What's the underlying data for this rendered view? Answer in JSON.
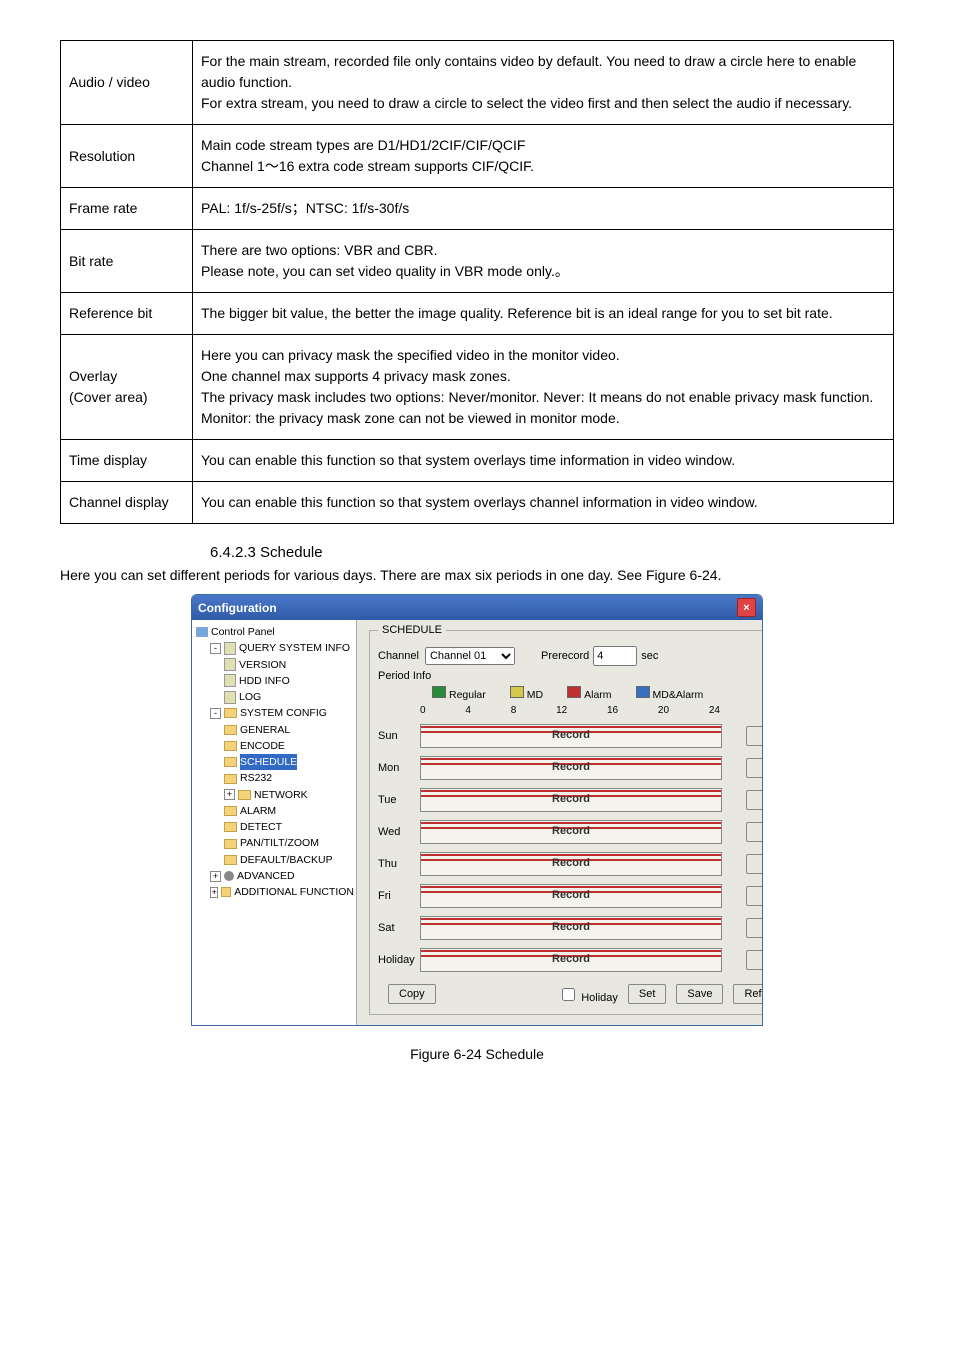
{
  "table": {
    "rows": [
      {
        "label": "Audio / video",
        "content": "For the main stream, recorded file only contains video by default. You need to draw a circle here to enable audio function.\nFor extra stream, you need to draw a circle to select the video first and then select the audio if necessary."
      },
      {
        "label": "Resolution",
        "content": "Main code stream types are D1/HD1/2CIF/CIF/QCIF\nChannel 1～16 extra code stream supports CIF/QCIF."
      },
      {
        "label": "Frame rate",
        "content": "PAL: 1f/s-25f/s；NTSC: 1f/s-30f/s"
      },
      {
        "label": "Bit rate",
        "content": "There are two options: VBR and CBR.\nPlease note, you can set video quality in VBR mode only.。"
      },
      {
        "label": "Reference bit",
        "content": "The bigger bit value, the better the image quality. Reference bit is an ideal range for you to set bit rate."
      },
      {
        "label": "Overlay\n(Cover area)",
        "content": "Here you can privacy mask the specified video in the monitor video.\nOne channel max supports 4 privacy mask zones.\nThe privacy mask includes two options: Never/monitor. Never: It means do not enable privacy mask function. Monitor: the privacy mask zone can not be viewed in monitor mode."
      },
      {
        "label": "Time display",
        "content": "You can enable this function so that system overlays time information in video window."
      },
      {
        "label": "Channel display",
        "content": "You can enable this function so that system overlays channel information in video window."
      }
    ]
  },
  "section_heading": "6.4.2.3  Schedule",
  "body_text": "Here you can set different periods for various days. There are max six periods in one day. See Figure 6-24.",
  "caption": "Figure 6-24 Schedule",
  "config": {
    "window_title": "Configuration",
    "close_glyph": "×",
    "tree": {
      "root": "Control Panel",
      "group1": "QUERY SYSTEM INFO",
      "g1_items": [
        "VERSION",
        "HDD INFO",
        "LOG"
      ],
      "group2": "SYSTEM CONFIG",
      "g2_items": [
        "GENERAL",
        "ENCODE",
        "SCHEDULE",
        "RS232",
        "NETWORK",
        "ALARM",
        "DETECT",
        "PAN/TILT/ZOOM",
        "DEFAULT/BACKUP"
      ],
      "group3": "ADVANCED",
      "group4": "ADDITIONAL FUNCTION"
    },
    "panel": {
      "legend": "SCHEDULE",
      "channel_label": "Channel",
      "channel_value": "Channel 01",
      "prerecord_label": "Prerecord",
      "prerecord_value": "4",
      "prerecord_unit": "sec",
      "period_info": "Period Info",
      "legend_items": {
        "regular": "Regular",
        "md": "MD",
        "alarm": "Alarm",
        "mdalarm": "MD&Alarm"
      },
      "ticks": [
        "0",
        "4",
        "8",
        "12",
        "16",
        "20",
        "24"
      ],
      "days": [
        "Sun",
        "Mon",
        "Tue",
        "Wed",
        "Thu",
        "Fri",
        "Sat",
        "Holiday"
      ],
      "bar_label": "Record",
      "set_btn": "Set",
      "copy_btn": "Copy",
      "holiday_chk": "Holiday",
      "set2_btn": "Set",
      "save_btn": "Save",
      "refresh_btn": "Refresh"
    }
  }
}
